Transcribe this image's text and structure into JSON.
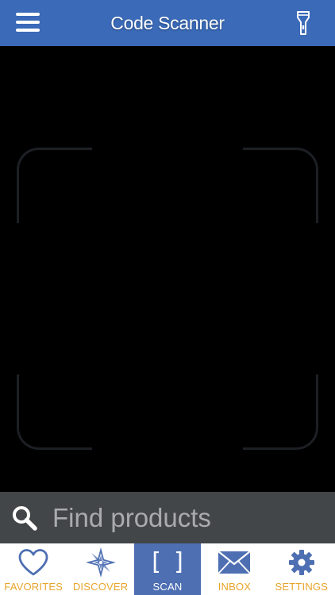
{
  "header": {
    "title": "Code Scanner",
    "menu_icon": "hamburger-menu-icon",
    "torch_icon": "flashlight-icon"
  },
  "search": {
    "placeholder": "Find products",
    "value": "",
    "icon": "search-icon"
  },
  "tabs": [
    {
      "label": "FAVORITES",
      "icon": "heart-icon",
      "active": false
    },
    {
      "label": "DISCOVER",
      "icon": "compass-icon",
      "active": false
    },
    {
      "label": "SCAN",
      "icon": "scan-brackets-icon",
      "active": true
    },
    {
      "label": "INBOX",
      "icon": "envelope-icon",
      "active": false
    },
    {
      "label": "SETTINGS",
      "icon": "gear-icon",
      "active": false
    }
  ],
  "colors": {
    "header": "#3a6ab8",
    "active_tab": "#4e6fb2",
    "tab_label": "#e8a42a",
    "search_bar": "#434649"
  }
}
